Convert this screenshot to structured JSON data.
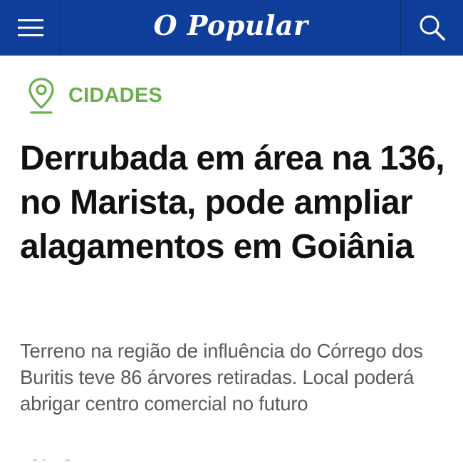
{
  "header": {
    "logo_text": "O Popular",
    "menu_icon": "hamburger-menu-icon",
    "search_icon": "search-icon",
    "background_color": "#0f3e9a"
  },
  "section": {
    "icon": "location-pin-icon",
    "label": "CIDADES",
    "color": "#6ab04c"
  },
  "article": {
    "headline": "Derrubada em área na 136, no Marista, pode ampliar alagamentos em Goiânia",
    "subtitle": "Terreno na região de influência do Córrego dos Buritis teve 86 árvores retiradas. Local poderá abrigar centro comercial no futuro"
  }
}
